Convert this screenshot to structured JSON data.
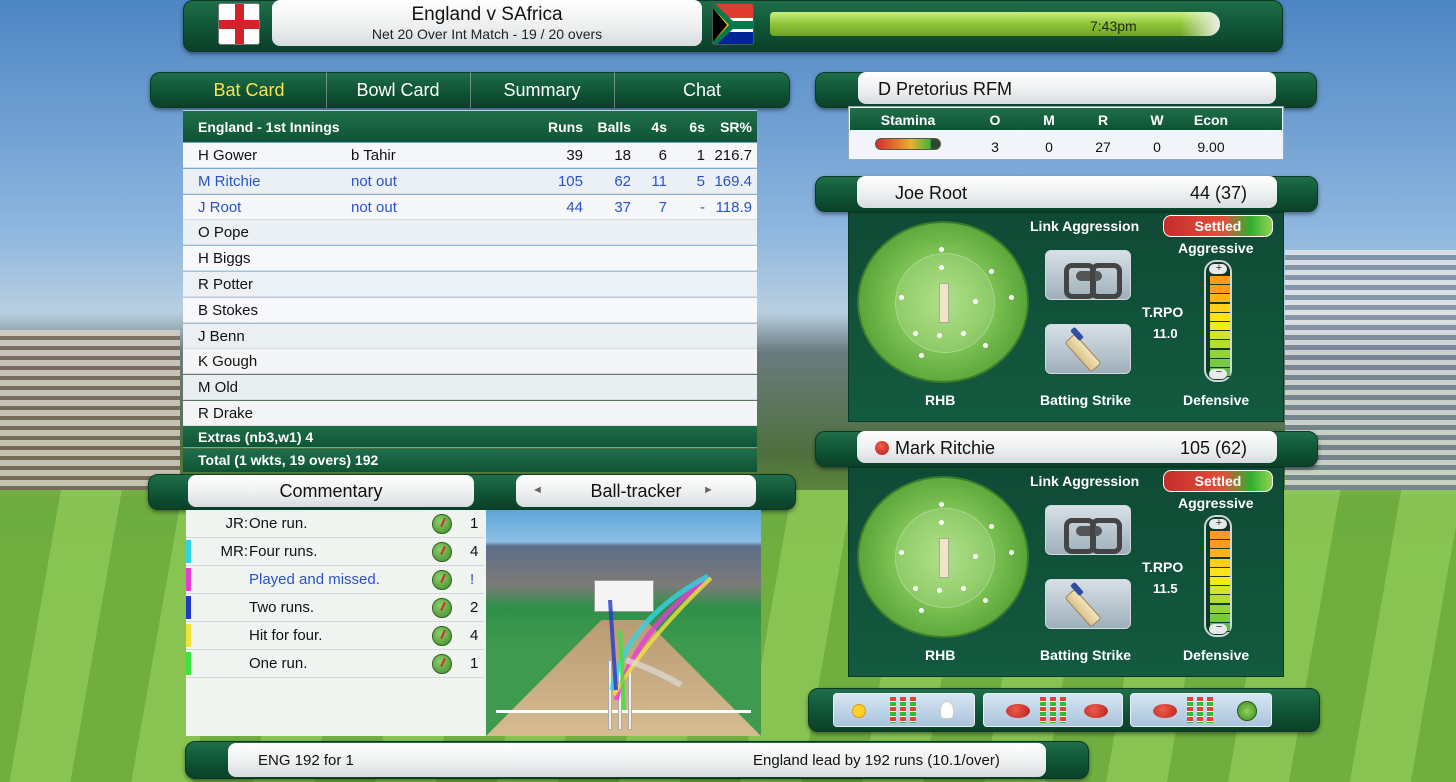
{
  "match": {
    "title": "England v SAfrica",
    "subtitle": "Net 20 Over Int Match - 19 / 20 overs",
    "time": "7:43pm"
  },
  "tabs": [
    {
      "label": "Bat Card",
      "active": true
    },
    {
      "label": "Bowl Card",
      "active": false
    },
    {
      "label": "Summary",
      "active": false
    },
    {
      "label": "Chat",
      "active": false
    }
  ],
  "batcard": {
    "headers": {
      "innings": "England - 1st Innings",
      "runs": "Runs",
      "balls": "Balls",
      "fours": "4s",
      "sixes": "6s",
      "sr": "SR%"
    },
    "rows": [
      {
        "name": "H Gower",
        "how": "b Tahir",
        "runs": "39",
        "balls": "18",
        "fours": "6",
        "sixes": "1",
        "sr": "216.7",
        "active": false
      },
      {
        "name": "M Ritchie",
        "how": "not out",
        "runs": "105",
        "balls": "62",
        "fours": "11",
        "sixes": "5",
        "sr": "169.4",
        "active": true
      },
      {
        "name": "J Root",
        "how": "not out",
        "runs": "44",
        "balls": "37",
        "fours": "7",
        "sixes": "-",
        "sr": "118.9",
        "active": true
      },
      {
        "name": "O Pope",
        "how": "",
        "runs": "",
        "balls": "",
        "fours": "",
        "sixes": "",
        "sr": "",
        "active": false
      },
      {
        "name": "H Biggs",
        "how": "",
        "runs": "",
        "balls": "",
        "fours": "",
        "sixes": "",
        "sr": "",
        "active": false
      },
      {
        "name": "R Potter",
        "how": "",
        "runs": "",
        "balls": "",
        "fours": "",
        "sixes": "",
        "sr": "",
        "active": false
      },
      {
        "name": "B Stokes",
        "how": "",
        "runs": "",
        "balls": "",
        "fours": "",
        "sixes": "",
        "sr": "",
        "active": false
      },
      {
        "name": "J Benn",
        "how": "",
        "runs": "",
        "balls": "",
        "fours": "",
        "sixes": "",
        "sr": "",
        "active": false
      },
      {
        "name": "K Gough",
        "how": "",
        "runs": "",
        "balls": "",
        "fours": "",
        "sixes": "",
        "sr": "",
        "active": false
      },
      {
        "name": "M Old",
        "how": "",
        "runs": "",
        "balls": "",
        "fours": "",
        "sixes": "",
        "sr": "",
        "active": false
      },
      {
        "name": "R Drake",
        "how": "",
        "runs": "",
        "balls": "",
        "fours": "",
        "sixes": "",
        "sr": "",
        "active": false
      }
    ],
    "extras": "Extras (nb3,w1) 4",
    "total": "Total (1 wkts, 19 overs) 192"
  },
  "commentary": {
    "tab_label": "Commentary",
    "tracker_label": "Ball-tracker",
    "tracker_prev": "◄",
    "tracker_next": "►",
    "items": [
      {
        "who": "JR:",
        "text": "One run.",
        "result": "1",
        "stripe": "",
        "blue": false
      },
      {
        "who": "MR:",
        "text": "Four runs.",
        "result": "4",
        "stripe": "#33d3e6",
        "blue": false
      },
      {
        "who": "",
        "text": "Played and missed.",
        "result": "!",
        "stripe": "#e83bd8",
        "blue": true
      },
      {
        "who": "",
        "text": "Two runs.",
        "result": "2",
        "stripe": "#2238c9",
        "blue": false
      },
      {
        "who": "",
        "text": "Hit for four.",
        "result": "4",
        "stripe": "#f0e23a",
        "blue": false
      },
      {
        "who": "",
        "text": "One run.",
        "result": "1",
        "stripe": "#3ee23e",
        "blue": false
      }
    ]
  },
  "bowler": {
    "name": "D Pretorius RFM",
    "headers": {
      "stamina": "Stamina",
      "overs": "O",
      "maidens": "M",
      "runs": "R",
      "wickets": "W",
      "econ": "Econ"
    },
    "stamina_level": 0.9,
    "overs": "3",
    "maidens": "0",
    "runs": "27",
    "wickets": "0",
    "econ": "9.00"
  },
  "batters": [
    {
      "name": "Joe Root",
      "score": "44 (37)",
      "on_strike": false,
      "link_aggression": "Link Aggression",
      "mode": "Settled",
      "aggressive": "Aggressive",
      "trpo_label": "T.RPO",
      "trpo": "11.0",
      "hand": "RHB",
      "batting_strike": "Batting Strike",
      "defensive": "Defensive",
      "plus": "+",
      "minus": "−"
    },
    {
      "name": "Mark Ritchie",
      "score": "105 (62)",
      "on_strike": true,
      "link_aggression": "Link Aggression",
      "mode": "Settled",
      "aggressive": "Aggressive",
      "trpo_label": "T.RPO",
      "trpo": "11.5",
      "hand": "RHB",
      "batting_strike": "Batting Strike",
      "defensive": "Defensive",
      "plus": "+",
      "minus": "−"
    }
  ],
  "footer": {
    "left": "ENG  192 for 1",
    "right": "England lead by 192 runs (10.1/over)"
  },
  "colors": {
    "panel_green": "#0f5436",
    "active_tab": "#ffe14a",
    "active_batter": "#2a52c8"
  }
}
